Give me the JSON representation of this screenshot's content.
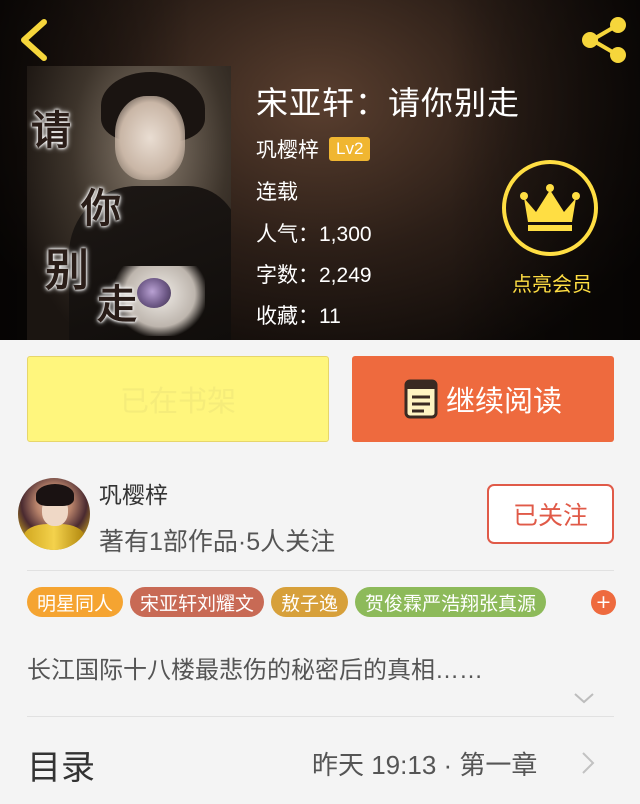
{
  "book": {
    "title": "宋亚轩：请你别走",
    "author": "巩樱梓",
    "level": "Lv2",
    "status": "连载",
    "popularity": "人气：1,300",
    "word_count": "字数：2,249",
    "favorites": "收藏：11",
    "cover_title_chars": [
      "请",
      "你",
      "别",
      "走"
    ]
  },
  "vip": {
    "label": "点亮会员"
  },
  "actions": {
    "shelf_label": "已在书架",
    "read_label": "继续阅读"
  },
  "author_card": {
    "name": "巩樱梓",
    "stats": "著有1部作品·5人关注",
    "follow_label": "已关注"
  },
  "tags": [
    {
      "label": "明星同人",
      "color": "#f5a431"
    },
    {
      "label": "宋亚轩刘耀文",
      "color": "#c86a55"
    },
    {
      "label": "敖子逸",
      "color": "#d7a03a"
    },
    {
      "label": "贺俊霖严浩翔张真源",
      "color": "#8dba5a"
    }
  ],
  "tags_more": "+",
  "summary": "长江国际十八楼最悲伤的秘密后的真相……",
  "toc": {
    "label": "目录",
    "latest": "昨天 19:13 · 第一章"
  },
  "icons": {
    "back": "back-arrow-icon",
    "share": "share-icon",
    "vip": "crown-icon",
    "read": "book-icon",
    "expand": "chevron-down-icon",
    "toc": "chevron-right-icon"
  },
  "colors": {
    "accent_orange": "#ee6a3e",
    "vip_yellow": "#ffde43",
    "shelf_yellow": "#fff67d",
    "follow_red": "#e05a48",
    "level_badge": "#f0b631"
  }
}
